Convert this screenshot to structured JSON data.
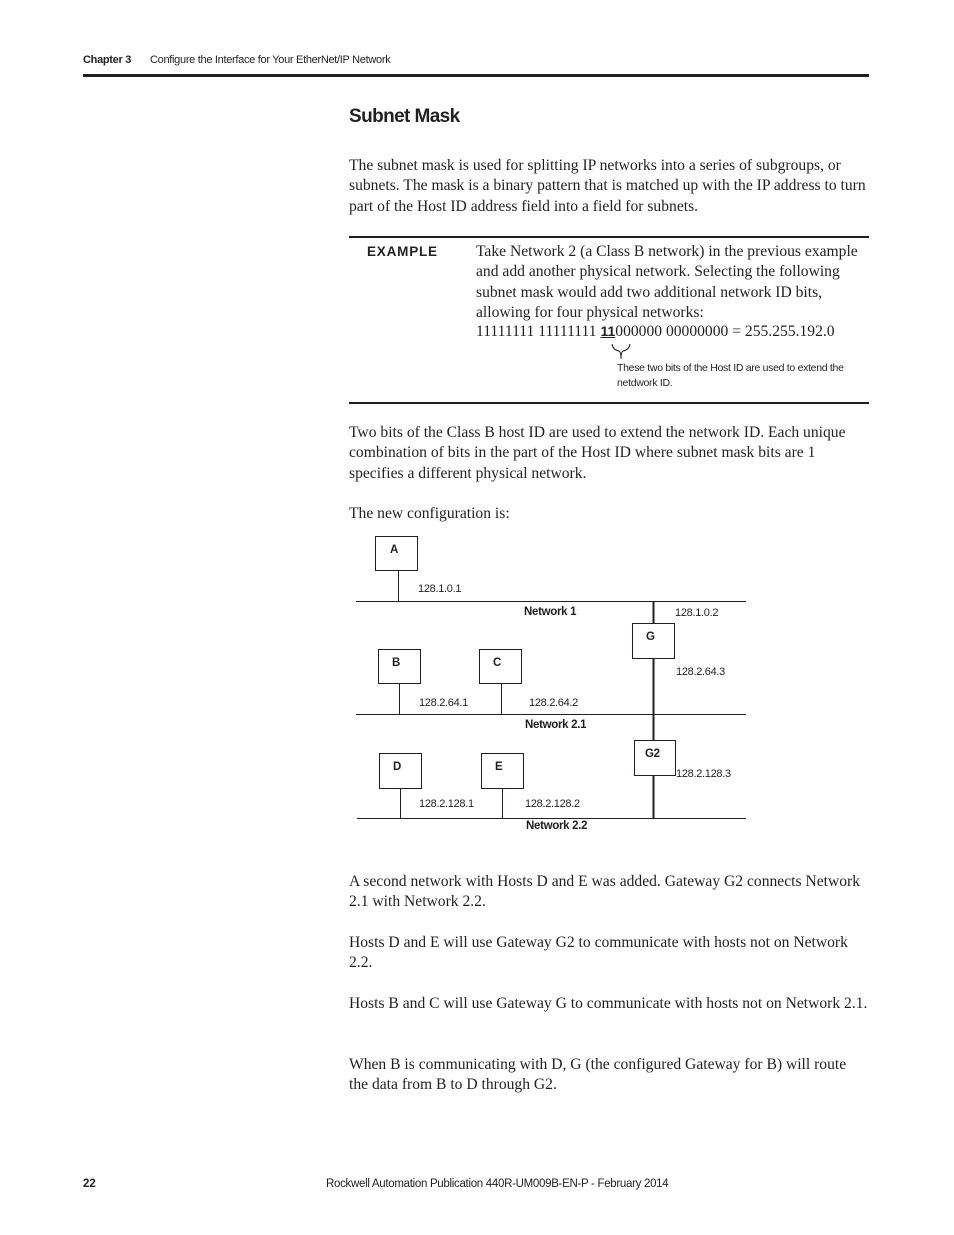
{
  "header": {
    "chapter": "Chapter 3",
    "title": "Configure the Interface for Your EtherNet/IP Network"
  },
  "section": {
    "title": "Subnet Mask",
    "intro": "The subnet mask is used for splitting IP networks into a series of subgroups, or subnets. The mask is a binary pattern that is matched up with the IP address to turn part of the Host ID address field into a field for subnets."
  },
  "example": {
    "label": "EXAMPLE",
    "text": "Take Network 2 (a Class B network) in the previous example and add another physical network. Selecting the following subnet mask would add two additional network ID bits, allowing for four physical networks:",
    "bits_prefix": "11111111 11111111 ",
    "bits_highlight": "11",
    "bits_suffix": "000000 00000000 = 255.255.192.0",
    "note": "These two bits of the Host ID are used to extend the netdwork ID."
  },
  "paragraphs": {
    "p1": "Two bits of the Class B host ID are used to extend the network ID. Each unique combination of bits in the part of the Host ID where subnet mask bits are 1 specifies a different physical network.",
    "p2": "The new configuration is:",
    "p3": "A second network with Hosts D and E was added. Gateway G2 connects Network 2.1 with Network 2.2.",
    "p4": "Hosts D and E will use Gateway G2 to communicate with hosts not on Network 2.2.",
    "p5": "Hosts B and C will use Gateway G to communicate with hosts not on Network 2.1.",
    "p6": "When B is communicating with D, G (the configured Gateway for B) will route the data from B to D through G2."
  },
  "diagram": {
    "nodes": {
      "A": "A",
      "B": "B",
      "C": "C",
      "D": "D",
      "E": "E",
      "G": "G",
      "G2": "G2"
    },
    "addresses": {
      "A": "128.1.0.1",
      "G_net1": "128.1.0.2",
      "G_net21": "128.2.64.3",
      "B": "128.2.64.1",
      "C": "128.2.64.2",
      "G2": "128.2.128.3",
      "D": "128.2.128.1",
      "E": "128.2.128.2"
    },
    "networks": {
      "net1": "Network 1",
      "net21": "Network 2.1",
      "net22": "Network 2.2"
    }
  },
  "footer": {
    "page_number": "22",
    "publication": "Rockwell Automation Publication 440R-UM009B-EN-P - February 2014"
  }
}
